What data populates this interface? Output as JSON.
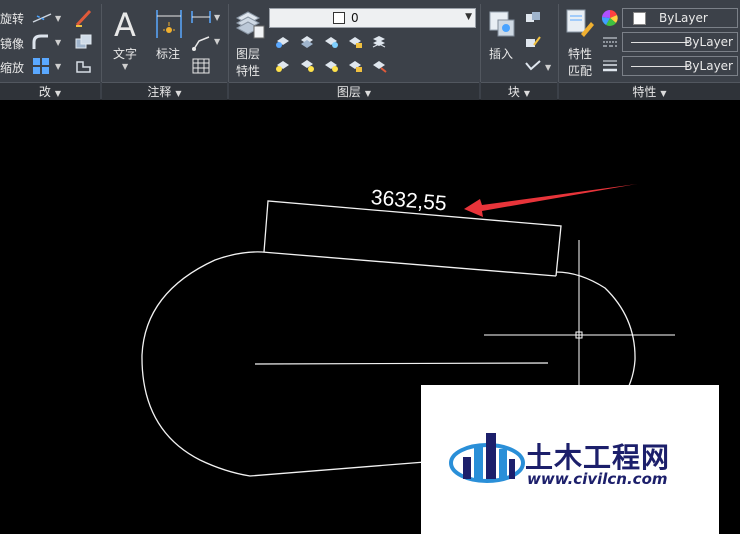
{
  "ribbon": {
    "modify": {
      "rotate": "旋转",
      "mirror": "镜像",
      "scale": "缩放",
      "title": "改"
    },
    "annotation": {
      "text": "文字",
      "dimension": "标注",
      "title": "注释"
    },
    "layers": {
      "layer_properties": "图层\n特性",
      "layer_properties_line1": "图层",
      "layer_properties_line2": "特性",
      "current_layer": "0",
      "title": "图层"
    },
    "block": {
      "insert": "插入",
      "title": "块"
    },
    "properties": {
      "match_line1": "特性",
      "match_line2": "匹配",
      "color": "ByLayer",
      "linetype": "ByLayer",
      "lineweight": "ByLayer",
      "title": "特性"
    }
  },
  "drawing": {
    "measurement": "3632,55",
    "arrow_color": "#e8343a",
    "line_color": "#ffffff",
    "background": "#000000"
  },
  "watermark": {
    "brand": "土木工程网",
    "url": "www.civilcn.com",
    "brand_color": "#1c1f6b",
    "accent_color": "#2a8fd8"
  },
  "icons": [
    "rotate-icon",
    "mirror-icon",
    "scale-icon",
    "trim-icon",
    "fillet-icon",
    "array-icon",
    "erase-icon",
    "copy-icon",
    "offset-icon",
    "text-icon",
    "dimension-icon",
    "linear-dim-icon",
    "leader-icon",
    "table-icon",
    "layer-properties-icon",
    "lightbulb-icon",
    "sun-icon",
    "lock-icon",
    "insert-icon",
    "create-block-icon",
    "edit-block-icon",
    "attribute-icon",
    "match-properties-icon",
    "color-wheel-icon",
    "list-icon",
    "crosshair-cursor"
  ]
}
